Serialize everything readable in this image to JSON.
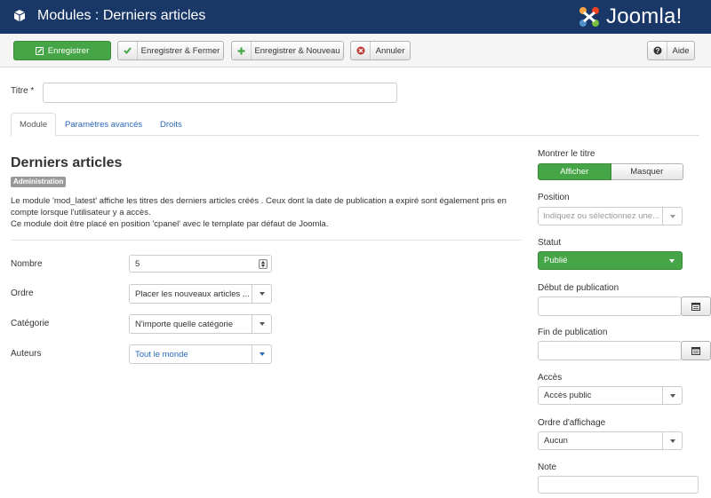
{
  "header": {
    "title": "Modules : Derniers articles",
    "logo_text": "Joomla!"
  },
  "toolbar": {
    "save": "Enregistrer",
    "save_close": "Enregistrer & Fermer",
    "save_new": "Enregistrer & Nouveau",
    "cancel": "Annuler",
    "help": "Aide"
  },
  "title_field": {
    "label": "Titre *",
    "value": ""
  },
  "tabs": [
    "Module",
    "Paramètres avancés",
    "Droits"
  ],
  "module": {
    "name": "Derniers articles",
    "badge": "Administration",
    "description": [
      "Le module 'mod_latest' affiche les titres des derniers articles créés . Ceux dont la date de publication a expiré sont également pris en",
      "compte lorsque l'utilisateur y a accès.",
      "Ce module doit être placé en position 'cpanel' avec le template par défaut de Joomla."
    ]
  },
  "fields": {
    "nombre": {
      "label": "Nombre",
      "value": "5"
    },
    "ordre": {
      "label": "Ordre",
      "value": "Placer les nouveaux articles ..."
    },
    "categorie": {
      "label": "Catégorie",
      "value": "N'importe quelle catégorie"
    },
    "auteurs": {
      "label": "Auteurs",
      "value": "Tout le monde"
    }
  },
  "sidebar": {
    "show_title": {
      "label": "Montrer le titre",
      "on": "Afficher",
      "off": "Masquer"
    },
    "position": {
      "label": "Position",
      "placeholder": "Indiquez ou sélectionnez une..."
    },
    "status": {
      "label": "Statut",
      "value": "Publié"
    },
    "publish_up": {
      "label": "Début de publication",
      "value": ""
    },
    "publish_down": {
      "label": "Fin de publication",
      "value": ""
    },
    "access": {
      "label": "Accès",
      "value": "Accès public"
    },
    "ordering": {
      "label": "Ordre d'affichage",
      "value": "Aucun"
    },
    "note": {
      "label": "Note",
      "value": ""
    }
  },
  "colors": {
    "header": "#1a3867",
    "success": "#46a546",
    "link": "#2a69b8",
    "danger": "#bd362f"
  }
}
